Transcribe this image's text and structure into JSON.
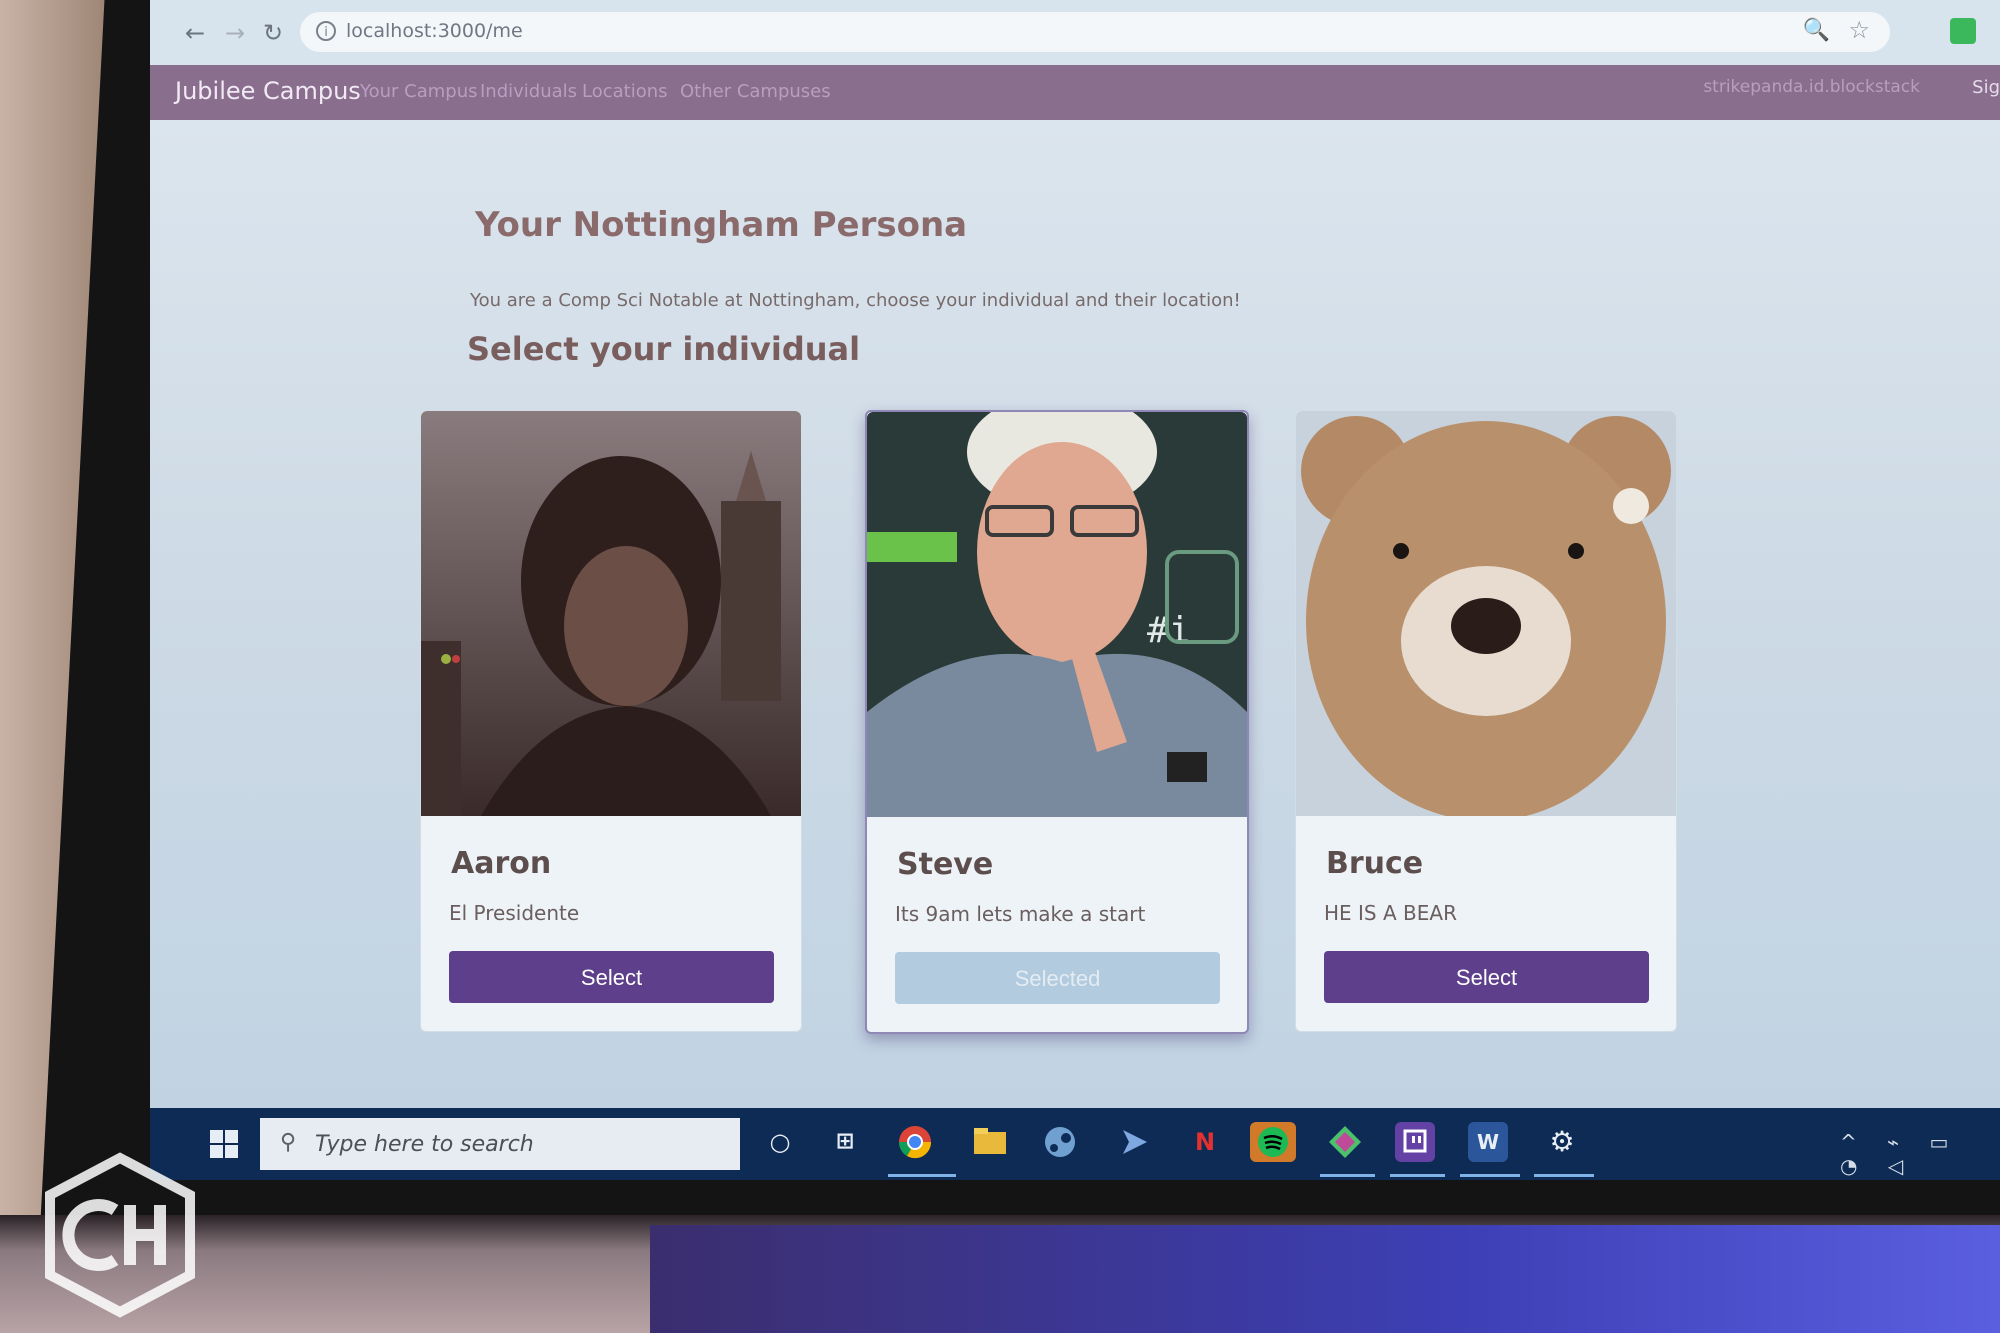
{
  "browser": {
    "url": "localhost:3000/me",
    "back_glyph": "←",
    "forward_glyph": "→",
    "reload_glyph": "↻",
    "info_glyph": "i",
    "zoom_glyph": "🔍",
    "bookmark_glyph": "☆"
  },
  "navbar": {
    "brand": "Jubilee Campus",
    "links": [
      "Your Campus",
      "Individuals",
      "Locations",
      "Other Campuses"
    ],
    "user": "strikepanda.id.blockstack",
    "signout": "Sig"
  },
  "page": {
    "title": "Your Nottingham Persona",
    "subtitle": "You are a Comp Sci Notable at Nottingham, choose your individual and their location!",
    "section_title": "Select your individual"
  },
  "individuals": [
    {
      "name": "Aaron",
      "description": "El Presidente",
      "button": "Select",
      "selected": false
    },
    {
      "name": "Steve",
      "description": "Its 9am lets make a start",
      "button": "Selected",
      "selected": true
    },
    {
      "name": "Bruce",
      "description": "HE IS A BEAR",
      "button": "Select",
      "selected": false
    }
  ],
  "taskbar": {
    "search_placeholder": "Type here to search",
    "icons": [
      "windows-start-icon",
      "cortana-icon",
      "task-view-icon",
      "chrome-icon",
      "file-explorer-icon",
      "steam-icon",
      "visual-studio-icon",
      "netflix-icon",
      "spotify-icon",
      "git-kraken-icon",
      "twitch-icon",
      "word-icon",
      "settings-icon"
    ],
    "cortana_glyph": "○",
    "task_view_glyph": "⊞",
    "netflix_glyph": "N",
    "word_glyph": "W",
    "settings_glyph": "⚙",
    "tray_glyphs": "^ ⌁ ▭ ◔ ◁"
  },
  "colors": {
    "navbar": "#8a6e8e",
    "primary_button": "#5d3f8b",
    "disabled_button": "#b3cbde",
    "taskbar": "#0d2b55"
  }
}
